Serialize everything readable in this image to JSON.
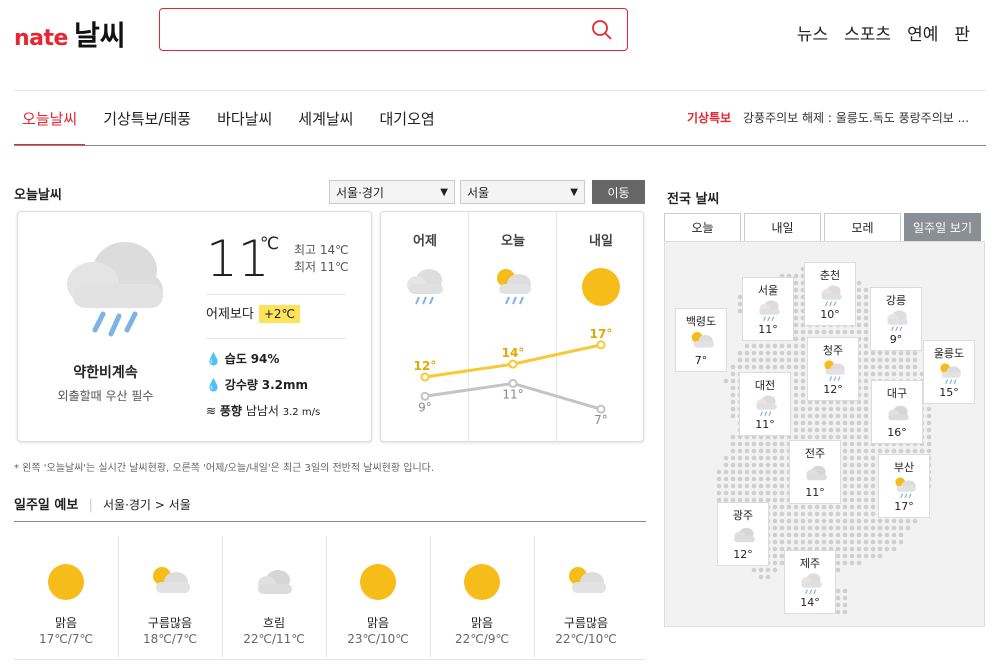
{
  "header": {
    "brand": "nate",
    "service": "날씨",
    "search_placeholder": "",
    "nav": [
      "뉴스",
      "스포츠",
      "연예",
      "판"
    ]
  },
  "tabs": [
    "오늘날씨",
    "기상특보/태풍",
    "바다날씨",
    "세계날씨",
    "대기오염"
  ],
  "notice": {
    "label": "기상특보",
    "text": "강풍주의보 해제 : 울릉도.독도 풍랑주의보 ..."
  },
  "today": {
    "title": "오늘날씨",
    "region_select": "서울·경기",
    "city_select": "서울",
    "go_button": "이동",
    "temp": "11",
    "unit": "℃",
    "high": "최고 14℃",
    "low": "최저 11℃",
    "compare_label": "어제보다",
    "compare_value": "+2℃",
    "condition": "약한비계속",
    "advice": "외출할때 우산 필수",
    "humidity_label": "습도",
    "humidity": "94%",
    "rain_label": "강수량",
    "rain": "3.2mm",
    "wind_label": "풍향",
    "wind": "남남서",
    "wind_speed": "3.2 m/s"
  },
  "three_days": {
    "days": [
      "어제",
      "오늘",
      "내일"
    ],
    "icons": [
      "rain-cloud-icon",
      "sun-cloud-rain-icon",
      "sun-icon"
    ],
    "highs": [
      "12°",
      "14°",
      "17°"
    ],
    "lows": [
      "9°",
      "11°",
      "7°"
    ]
  },
  "chart_data": {
    "type": "line",
    "categories": [
      "어제",
      "오늘",
      "내일"
    ],
    "series": [
      {
        "values": [
          12,
          14,
          17
        ],
        "color": "#f7c935"
      },
      {
        "values": [
          9,
          11,
          7
        ],
        "color": "#c4c4c4"
      }
    ]
  },
  "footnote": "* 왼쪽 '오늘날씨'는 실시간 날씨현황, 오른쪽 '어제/오늘/내일'은 최근 3일의 전반적 날씨현황 입니다.",
  "weekly": {
    "title": "일주일 예보",
    "breadcrumb": "서울·경기 > 서울",
    "items": [
      {
        "cond": "맑음",
        "temp": "17℃/7℃",
        "icon": "sun-icon"
      },
      {
        "cond": "구름많음",
        "temp": "18℃/7℃",
        "icon": "sun-cloud-icon"
      },
      {
        "cond": "흐림",
        "temp": "22℃/11℃",
        "icon": "cloud-icon"
      },
      {
        "cond": "맑음",
        "temp": "23℃/10℃",
        "icon": "sun-icon"
      },
      {
        "cond": "맑음",
        "temp": "22℃/9℃",
        "icon": "sun-icon"
      },
      {
        "cond": "구름많음",
        "temp": "22℃/10℃",
        "icon": "sun-cloud-icon"
      }
    ]
  },
  "national": {
    "title": "전국 날씨",
    "tabs": [
      "오늘",
      "내일",
      "모레",
      "일주일 보기"
    ],
    "cities": [
      {
        "name": "백령도",
        "temp": "7°",
        "icon": "sun-cloud-icon"
      },
      {
        "name": "서울",
        "temp": "11°",
        "icon": "rain-cloud-icon"
      },
      {
        "name": "춘천",
        "temp": "10°",
        "icon": "rain-cloud-icon"
      },
      {
        "name": "강릉",
        "temp": "9°",
        "icon": "rain-cloud-icon"
      },
      {
        "name": "울릉도",
        "temp": "15°",
        "icon": "sun-cloud-rain-icon"
      },
      {
        "name": "청주",
        "temp": "12°",
        "icon": "sun-cloud-rain-icon"
      },
      {
        "name": "대전",
        "temp": "11°",
        "icon": "rain-cloud-icon"
      },
      {
        "name": "대구",
        "temp": "16°",
        "icon": "cloud-icon"
      },
      {
        "name": "전주",
        "temp": "11°",
        "icon": "cloud-icon"
      },
      {
        "name": "부산",
        "temp": "17°",
        "icon": "sun-cloud-rain-icon"
      },
      {
        "name": "광주",
        "temp": "12°",
        "icon": "cloud-icon"
      },
      {
        "name": "제주",
        "temp": "14°",
        "icon": "rain-cloud-icon"
      }
    ]
  }
}
